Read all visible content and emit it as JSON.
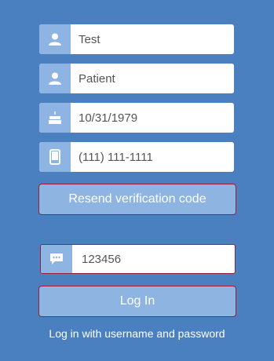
{
  "form": {
    "first_name": {
      "value": "Test",
      "icon": "user-icon"
    },
    "last_name": {
      "value": "Patient",
      "icon": "user-icon"
    },
    "dob": {
      "value": "10/31/1979",
      "icon": "birthday-cake-icon"
    },
    "phone": {
      "value": "(111) 111-1111",
      "icon": "mobile-phone-icon"
    },
    "resend_label": "Resend verification code",
    "code": {
      "value": "123456",
      "icon": "chat-bubble-icon"
    },
    "login_label": "Log In",
    "alt_login_link": "Log in with username and password"
  },
  "colors": {
    "background": "#4a80c0",
    "icon_box": "#8db4e2",
    "button": "#8eb5e1",
    "button_border": "#9b1c3a"
  }
}
